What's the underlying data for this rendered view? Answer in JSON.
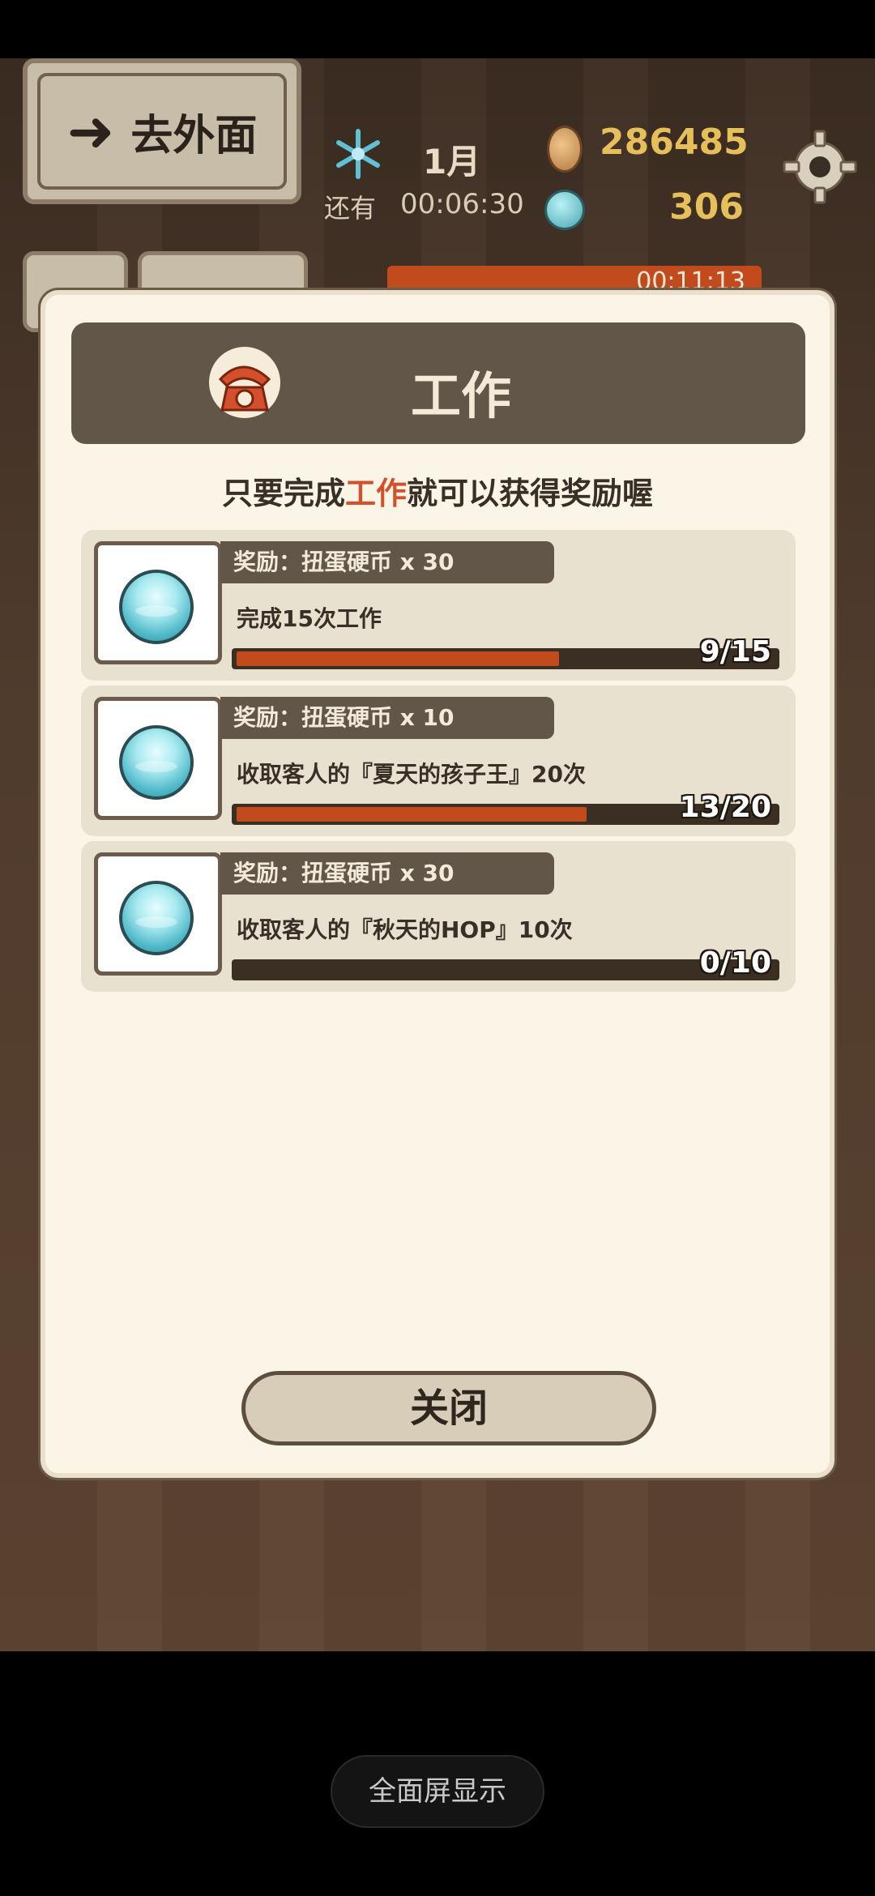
{
  "hud": {
    "go_out_label": "去外面",
    "month": "1月",
    "remain_label": "还有",
    "timer": "00:06:30",
    "coins": "286485",
    "gems": "306",
    "background_timer": "00:11:13"
  },
  "dialog": {
    "title": "工作",
    "subtitle_pre": "只要完成",
    "subtitle_highlight": "工作",
    "subtitle_post": "就可以获得奖励喔",
    "close_label": "关闭"
  },
  "tasks": [
    {
      "reward": "奖励：扭蛋硬币 x 30",
      "desc": "完成15次工作",
      "progress": "9/15",
      "current": 9,
      "total": 15
    },
    {
      "reward": "奖励：扭蛋硬币 x 10",
      "desc": "收取客人的『夏天的孩子王』20次",
      "progress": "13/20",
      "current": 13,
      "total": 20
    },
    {
      "reward": "奖励：扭蛋硬币 x 30",
      "desc": "收取客人的『秋天的HOP』10次",
      "progress": "0/10",
      "current": 0,
      "total": 10
    }
  ],
  "system": {
    "fullscreen_label": "全面屏显示"
  },
  "colors": {
    "accent": "#d2502b",
    "progress_fill": "#c24b1d",
    "header_bg": "#625649",
    "dialog_bg": "#fbf5e7"
  }
}
